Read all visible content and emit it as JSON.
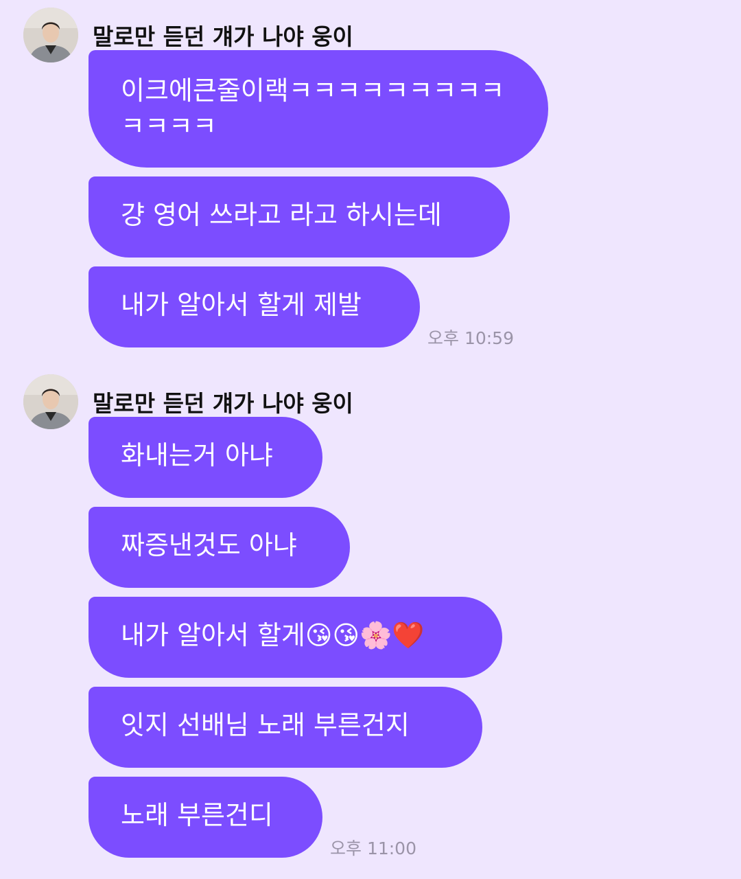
{
  "groups": [
    {
      "sender": "말로만 듣던 걔가 나야 웅이",
      "messages": [
        "이크에큰줄이랙ㅋㅋㅋㅋㅋㅋㅋㅋㅋㅋㅋㅋㅋ",
        "걍 영어 쓰라고 라고 하시는데",
        "내가 알아서 할게 제발"
      ],
      "time": "오후 10:59"
    },
    {
      "sender": "말로만 듣던 걔가 나야 웅이",
      "messages": [
        "화내는거 아냐",
        "짜증낸것도 아냐",
        "내가 알아서 할게😘😘🌸❤️",
        "잇지 선배님 노래 부른건지",
        "노래 부른건디"
      ],
      "time": "오후 11:00"
    }
  ],
  "colors": {
    "background": "#efe6fe",
    "bubble": "#7c4dff",
    "bubble_text": "#ffffff",
    "time_text": "#9b94a8"
  }
}
